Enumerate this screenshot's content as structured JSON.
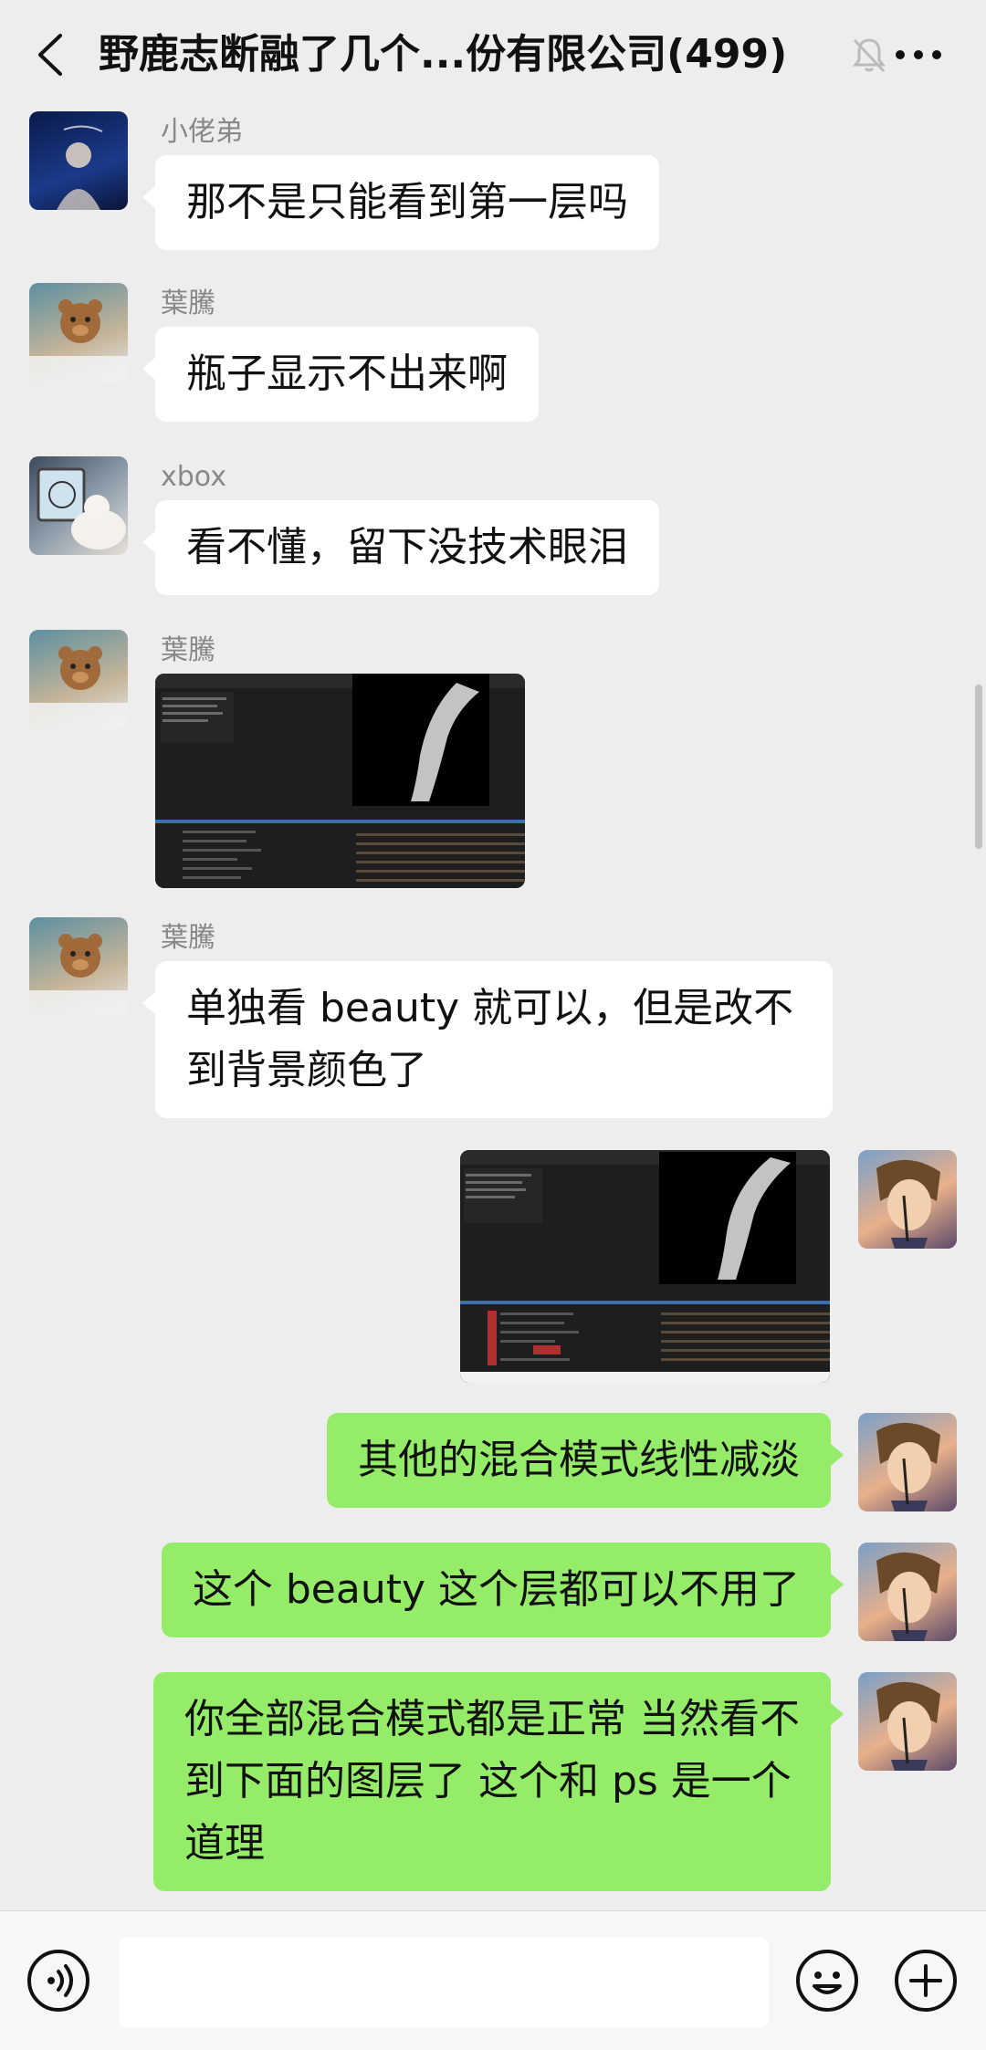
{
  "header": {
    "title": "野鹿志断融了几个...份有限公司(499)",
    "back_icon": "chevron-left-icon",
    "mute_icon": "bell-off-icon",
    "more_icon": "more-icon"
  },
  "messages": [
    {
      "side": "in",
      "sender": "小佬弟",
      "text": "那不是只能看到第一层吗"
    },
    {
      "side": "in",
      "sender": "葉騰",
      "text": "瓶子显示不出来啊"
    },
    {
      "side": "in",
      "sender": "xbox",
      "text": "看不懂，留下没技术眼泪"
    },
    {
      "side": "in",
      "sender": "葉騰",
      "type": "image"
    },
    {
      "side": "in",
      "sender": "葉騰",
      "text": "单独看 beauty 就可以，但是改不到背景颜色了"
    },
    {
      "side": "out",
      "type": "image"
    },
    {
      "side": "out",
      "text": "其他的混合模式线性减淡"
    },
    {
      "side": "out",
      "text": "这个 beauty 这个层都可以不用了"
    },
    {
      "side": "out",
      "text": "你全部混合模式都是正常 当然看不到下面的图层了 这个和 ps 是一个道理"
    }
  ],
  "input": {
    "voice_icon": "voice-icon",
    "emoji_icon": "emoji-icon",
    "plus_icon": "plus-icon"
  },
  "colors": {
    "bg": "#ededed",
    "outgoing": "#95ec69",
    "incoming": "#ffffff"
  }
}
